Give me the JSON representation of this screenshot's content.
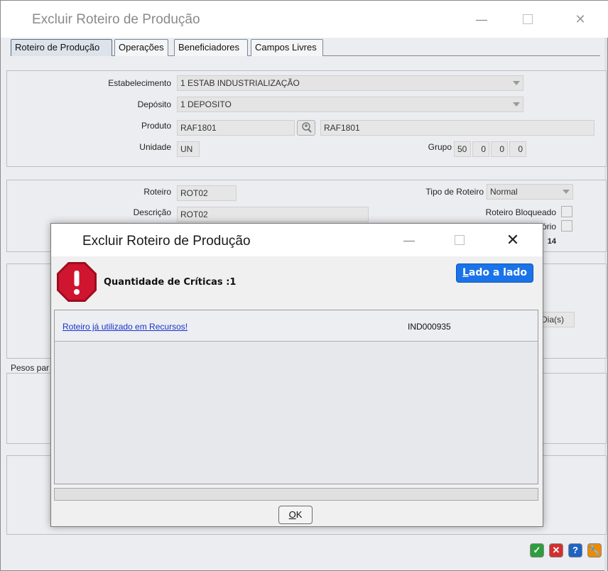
{
  "main_window": {
    "title": "Excluir Roteiro de Produção",
    "tabs": [
      "Roteiro de Produção",
      "Operações",
      "Beneficiadores",
      "Campos Livres"
    ],
    "form": {
      "estabelecimento_label": "Estabelecimento",
      "estabelecimento_value": "1 ESTAB INDUSTRIALIZAÇÃO",
      "deposito_label": "Depósito",
      "deposito_value": "1 DEPOSITO",
      "produto_label": "Produto",
      "produto_code": "RAF1801",
      "produto_desc": "RAF1801",
      "unidade_label": "Unidade",
      "unidade_value": "UN",
      "grupo_label": "Grupo",
      "grupo_values": [
        "50",
        "0",
        "0",
        "0"
      ],
      "roteiro_label": "Roteiro",
      "roteiro_value": "ROT02",
      "descricao_label": "Descrição",
      "descricao_value": "ROT02",
      "tipo_roteiro_label": "Tipo de Roteiro",
      "tipo_roteiro_value": "Normal",
      "roteiro_bloqueado_label": "Roteiro Bloqueado",
      "partial_label_1": "tório",
      "partial_value_14": "14",
      "partial_dias": "Dia(s)",
      "pesos_partial": "Pesos par"
    }
  },
  "dialog": {
    "title": "Excluir Roteiro de Produção",
    "criticas_label": "Quantidade de Críticas :1",
    "side_button_underlined": "L",
    "side_button_rest": "ado a lado",
    "rows": [
      {
        "message": "Roteiro já utilizado em Recursos!",
        "code": "IND000935"
      }
    ],
    "ok_underlined": "O",
    "ok_rest": "K"
  },
  "colors": {
    "accent_blue": "#1a73e8",
    "stop_red": "#c8102e",
    "link_blue": "#1a33cc",
    "bottom_ok": "#2e9e3e",
    "bottom_cancel": "#d32f2f",
    "bottom_help": "#1e63c5",
    "bottom_tools": "#f08a00"
  },
  "icons": {
    "lookup": "search-person-icon",
    "stop": "stop-sign-icon",
    "bottom": [
      "check-icon",
      "cancel-icon",
      "help-icon",
      "wrench-icon"
    ]
  }
}
